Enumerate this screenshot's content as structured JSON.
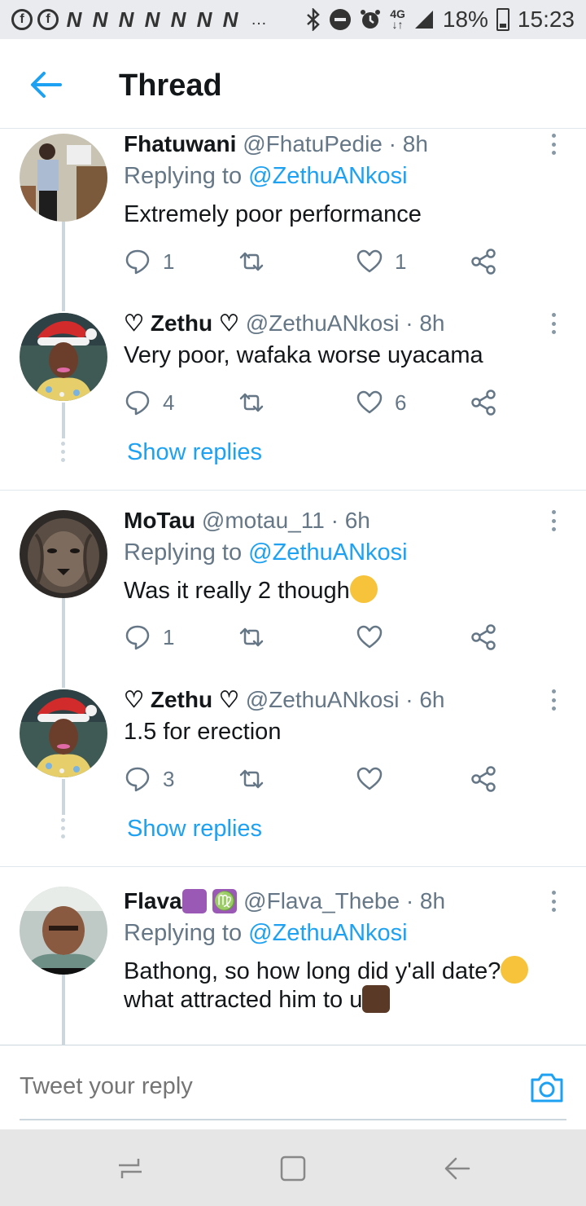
{
  "status_bar": {
    "network": "4G",
    "battery": "18%",
    "time": "15:23",
    "n_icons": [
      "N",
      "N",
      "N",
      "N",
      "N",
      "N",
      "N"
    ],
    "overflow": "…"
  },
  "header": {
    "title": "Thread"
  },
  "tweets": [
    {
      "name": "Fhatuwani",
      "handle": "@FhatuPedie",
      "time": "· 8h",
      "replying_label": "Replying to ",
      "replying_to": "@ZethuANkosi",
      "text": "Extremely poor performance",
      "replies": "1",
      "retweets": "",
      "likes": "1"
    },
    {
      "name": "♡ Zethu ♡",
      "handle": "@ZethuANkosi",
      "time": "· 8h",
      "text": "Very poor, wafaka worse uyacama",
      "replies": "4",
      "retweets": "",
      "likes": "6",
      "show_replies": "Show replies"
    },
    {
      "name": "MoTau",
      "handle": "@motau_11",
      "time": "· 6h",
      "replying_label": "Replying to ",
      "replying_to": "@ZethuANkosi",
      "text": "Was it really 2 though",
      "replies": "1",
      "retweets": "",
      "likes": ""
    },
    {
      "name": "♡ Zethu ♡",
      "handle": "@ZethuANkosi",
      "time": "· 6h",
      "text": "1.5 for erection",
      "replies": "3",
      "retweets": "",
      "likes": "",
      "show_replies": "Show replies"
    },
    {
      "name": "Flava",
      "name_badge": "♍",
      "handle": "@Flava_Thebe",
      "time": "· 8h",
      "replying_label": "Replying to ",
      "replying_to": "@ZethuANkosi",
      "text_line1": "Bathong, so how long did y'all date?",
      "text_line2": "what attracted him to u"
    }
  ],
  "reply_box": {
    "placeholder": "Tweet your reply"
  },
  "colors": {
    "accent": "#1da1f2",
    "muted": "#657786",
    "text": "#14171a"
  }
}
